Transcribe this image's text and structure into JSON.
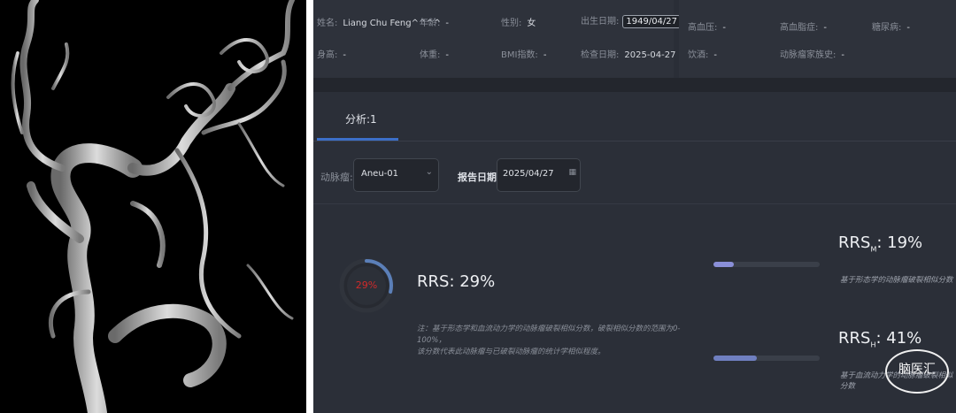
{
  "patient": {
    "name_label": "姓名:",
    "name_value": "Liang Chu Feng^^^^",
    "age_label": "年龄:",
    "age_value": "-",
    "sex_label": "性别:",
    "sex_value": "女",
    "dob_label": "出生日期:",
    "dob_value": "1949/04/27",
    "height_label": "身高:",
    "height_value": "-",
    "weight_label": "体重:",
    "weight_value": "-",
    "bmi_label": "BMI指数:",
    "bmi_value": "-",
    "exam_label": "检查日期:",
    "exam_value": "2025-04-27"
  },
  "history": {
    "hypertension_label": "高血压:",
    "hypertension_value": "-",
    "hyperlipidemia_label": "高血脂症:",
    "hyperlipidemia_value": "-",
    "diabetes_label": "糖尿病:",
    "diabetes_value": "-",
    "drinking_label": "饮酒:",
    "drinking_value": "-",
    "family_label": "动脉瘤家族史:",
    "family_value": "-"
  },
  "tabs": {
    "analysis": "分析:1"
  },
  "filters": {
    "aneurysm_label": "动脉瘤:",
    "aneurysm_value": "Aneu-01",
    "report_date_label": "报告日期:",
    "report_date_value": "2025/04/27"
  },
  "rrs": {
    "title": "RRS: 29%",
    "ring_text": "29%",
    "percent": 29,
    "note_line1": "注：基于形态学和血流动力学的动脉瘤破裂相似分数，破裂相似分数的范围为0-100%，",
    "note_line2": "该分数代表此动脉瘤与已破裂动脉瘤的统计学相似程度。"
  },
  "rrs_m": {
    "prefix": "RRS",
    "sub": "M",
    "value": ": 19%",
    "percent": 19,
    "note": "基于形态学的动脉瘤破裂相似分数"
  },
  "rrs_h": {
    "prefix": "RRS",
    "sub": "H",
    "value": ": 41%",
    "percent": 41,
    "note": "基于血流动力学的动脉瘤破裂相似分数"
  },
  "watermark": "脑医汇",
  "colors": {
    "accent": "#3c6fc8",
    "ring": "#5b7fb8",
    "danger": "#d02a2a",
    "bar_m": "#8a8fd8",
    "bar_h": "#6f7fc0"
  }
}
